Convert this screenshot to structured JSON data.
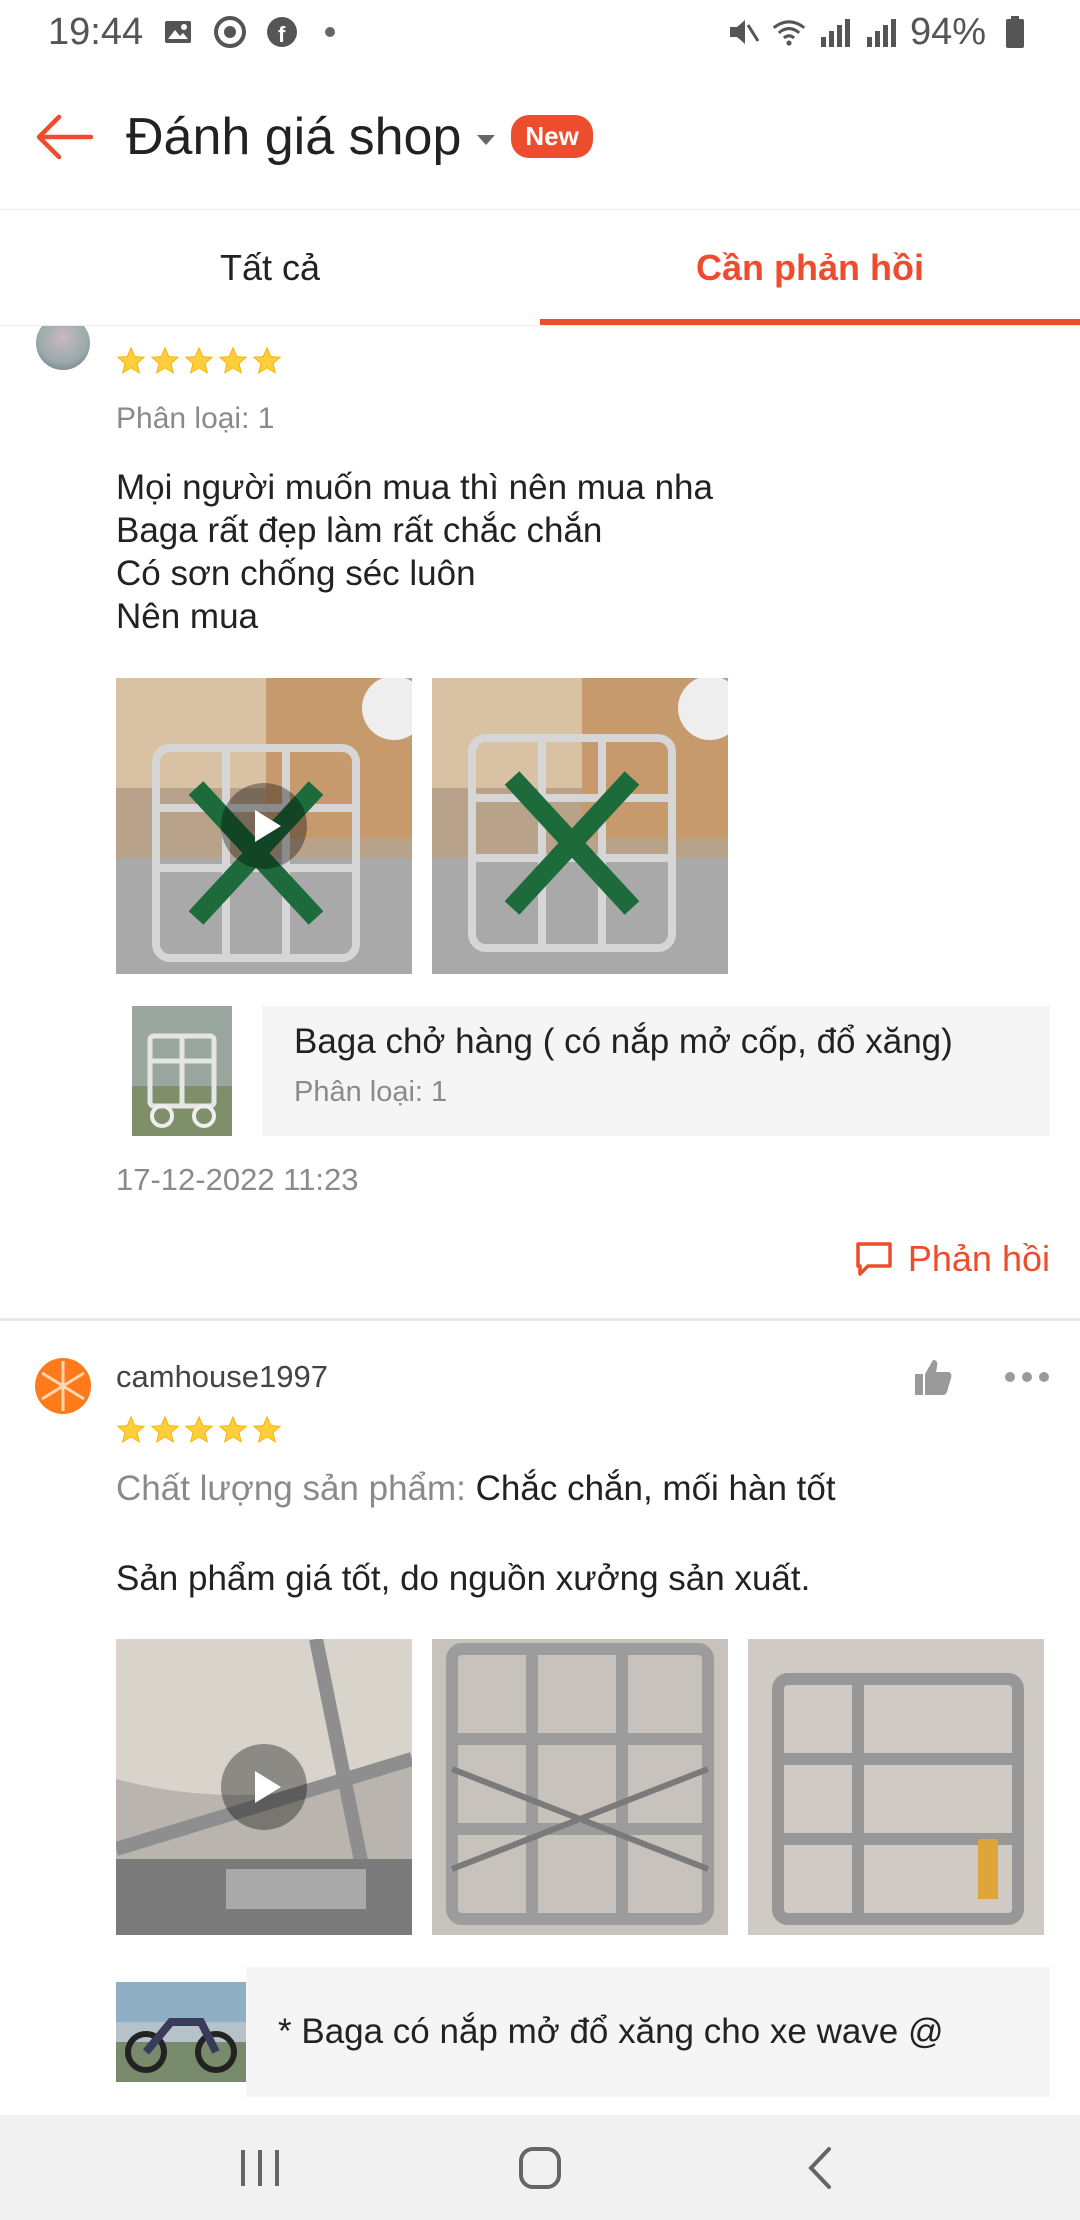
{
  "status_bar": {
    "time": "19:44",
    "battery": "94%"
  },
  "header": {
    "title": "Đánh giá shop",
    "badge": "New"
  },
  "tabs": [
    {
      "label": "Tất cả",
      "active": false
    },
    {
      "label": "Cần phản hồi",
      "active": true
    }
  ],
  "reviews": [
    {
      "rating": 5,
      "variant": "Phân loại: 1",
      "text_lines": [
        "Mọi người muốn mua thì nên mua nha",
        "Baga rất đẹp làm rất chắc chắn",
        "Có sơn chống séc luôn",
        "Nên mua"
      ],
      "media_count": 2,
      "product_name": "Baga chở hàng ( có nắp mở cốp,  đổ xăng)",
      "product_variant": "Phân loại: 1",
      "timestamp": "17-12-2022 11:23",
      "reply_label": "Phản hồi"
    },
    {
      "username": "camhouse1997",
      "rating": 5,
      "quality_label": "Chất lượng sản phẩm:",
      "quality_value": "Chắc chắn, mối hàn tốt",
      "text": "Sản phẩm giá tốt, do nguồn xưởng sản xuất.",
      "media_count": 3,
      "product_name": "* Baga có nắp mở đổ xăng cho xe wave @"
    }
  ],
  "colors": {
    "accent": "#ee4d2d",
    "star": "#ffce3d"
  }
}
